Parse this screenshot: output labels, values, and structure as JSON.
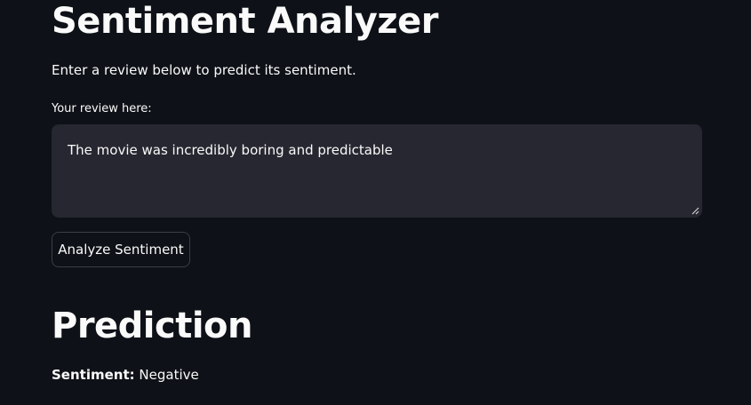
{
  "header": {
    "title": "Sentiment Analyzer",
    "subtitle": "Enter a review below to predict its sentiment."
  },
  "form": {
    "label": "Your review here:",
    "review_value": "The movie was incredibly boring and predictable",
    "button_label": "Analyze Sentiment"
  },
  "prediction": {
    "heading": "Prediction",
    "sentiment_key": "Sentiment:",
    "sentiment_value": "Negative"
  },
  "colors": {
    "background": "#0e1117",
    "text": "#fafafa",
    "input_background": "#262730",
    "button_border": "#3c3e47"
  }
}
